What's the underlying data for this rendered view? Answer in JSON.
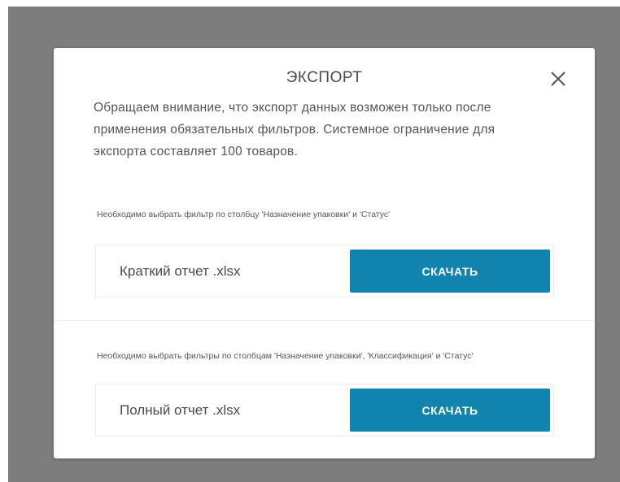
{
  "modal": {
    "title": "ЭКСПОРТ",
    "notice": "Обращаем внимание, что экспорт данных возможен только после применения обязательных фильтров. Системное ограничение для экспорта составляет 100 товаров.",
    "close_icon": "close-icon"
  },
  "reports": [
    {
      "requirement": "Необходимо выбрать фильтр по столбцу 'Назначение упаковки' и 'Статус'",
      "name": "Краткий отчет .xlsx",
      "button_label": "СКАЧАТЬ"
    },
    {
      "requirement": "Необходимо выбрать фильтры по столбцам 'Назначение упаковки', 'Классификация' и 'Статус'",
      "name": "Полный отчет .xlsx",
      "button_label": "СКАЧАТЬ"
    }
  ],
  "colors": {
    "overlay": "#7d7d7d",
    "accent": "#1184ad",
    "text": "#4a4a4a"
  }
}
